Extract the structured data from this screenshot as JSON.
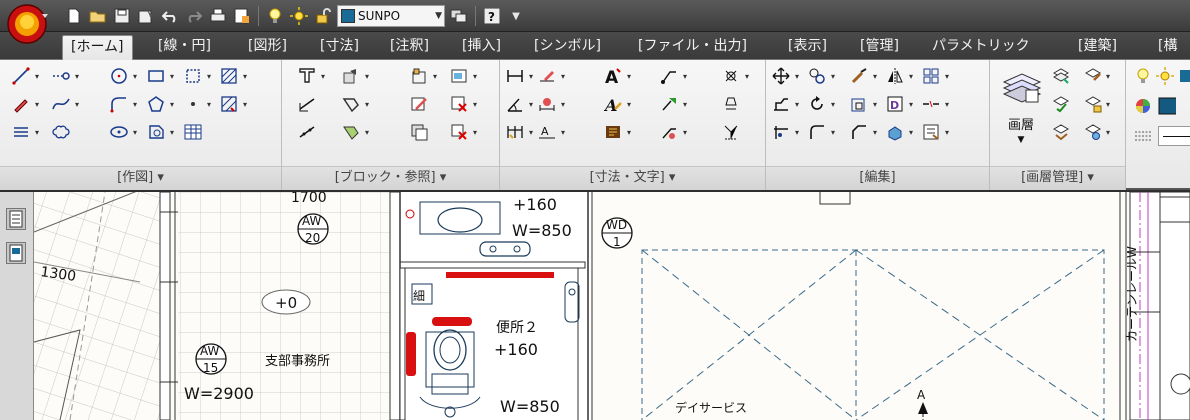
{
  "qat": {
    "layer_name": "SUNPO"
  },
  "tabs": [
    {
      "label": "[ホーム]"
    },
    {
      "label": "[線・円]"
    },
    {
      "label": "[図形]"
    },
    {
      "label": "[寸法]"
    },
    {
      "label": "[注釈]"
    },
    {
      "label": "[挿入]"
    },
    {
      "label": "[シンボル]"
    },
    {
      "label": "[ファイル・出力]"
    },
    {
      "label": "[表示]"
    },
    {
      "label": "[管理]"
    },
    {
      "label": "パラメトリック"
    },
    {
      "label": "[建築]"
    },
    {
      "label": "[構造"
    }
  ],
  "panels": {
    "draw": "[作図] ▾",
    "block": "[ブロック・参照] ▾",
    "dim": "[寸法・文字] ▾",
    "edit": "[編集]",
    "layer": "[画層管理] ▾",
    "layer_big_label": "画層"
  },
  "drawing": {
    "labels": {
      "dim_1300": "1300",
      "w_850_top": "W=850",
      "h_160_top": "+160",
      "h_0": "+0",
      "office": "支部事務所",
      "w_2900": "W=2900",
      "toilet": "便所２",
      "h_160": "+160",
      "w_850_bottom": "W=850",
      "day_service": "デイサービス",
      "kosaku": "細",
      "curtain_rail": "カーテンレールW",
      "dim_1700": "1700",
      "grid_a": "A"
    },
    "tags": {
      "aw20": {
        "top": "AW",
        "bottom": "20"
      },
      "aw15": {
        "top": "AW",
        "bottom": "15"
      },
      "wd1": {
        "top": "WD",
        "bottom": "1"
      }
    }
  },
  "colors": {
    "accent": "#e01010",
    "tab_bg": "#3e3e3e",
    "ribbon_bg": "#efefef",
    "drawing_bg": "#fdfcf8"
  }
}
